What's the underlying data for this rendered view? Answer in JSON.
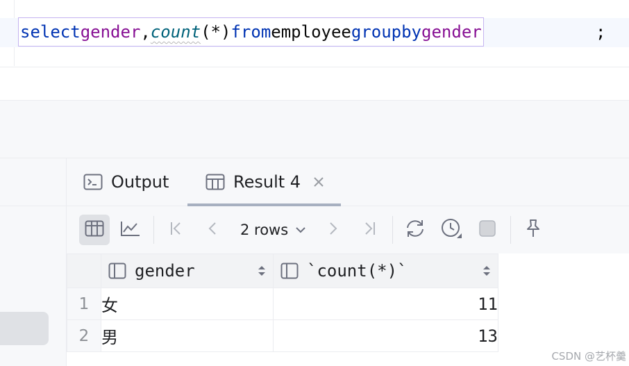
{
  "editor": {
    "sql": {
      "kw_select": "select",
      "col_gender": "gender",
      "comma": ",",
      "fn_count": "count",
      "args": "(*)",
      "kw_from": "from",
      "table": "employee",
      "kw_group": "group",
      "kw_by": "by",
      "col_gender2": "gender",
      "semicolon": ";"
    },
    "colors": {
      "keyword": "#0033b3",
      "column": "#871094",
      "function": "#00627a"
    }
  },
  "tabs": [
    {
      "label": "Output",
      "icon": "console-icon",
      "active": false
    },
    {
      "label": "Result 4",
      "icon": "table-icon",
      "active": true,
      "closable": true
    }
  ],
  "toolbar": {
    "view_table_icon": "table-view-icon",
    "view_chart_icon": "chart-view-icon",
    "first_page_icon": "first-page-icon",
    "prev_page_icon": "previous-page-icon",
    "rows_label": "2 rows",
    "next_page_icon": "next-page-icon",
    "last_page_icon": "last-page-icon",
    "refresh_icon": "refresh-icon",
    "history_icon": "history-icon",
    "stop_icon": "stop-icon",
    "pin_icon": "pin-icon"
  },
  "grid": {
    "columns": [
      {
        "label": "gender",
        "icon": "column-icon"
      },
      {
        "label": "`count(*)`",
        "icon": "column-icon"
      }
    ],
    "rows": [
      {
        "num": "1",
        "gender": "女",
        "count": "11"
      },
      {
        "num": "2",
        "gender": "男",
        "count": "13"
      }
    ]
  },
  "watermark": "CSDN @艺杯羹"
}
